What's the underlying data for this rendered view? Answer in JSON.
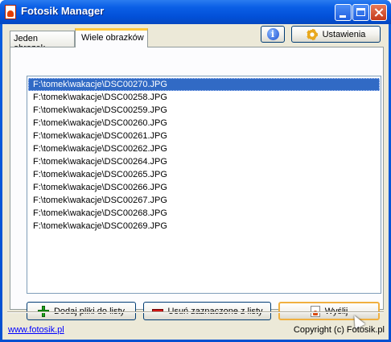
{
  "window": {
    "title": "Fotosik Manager"
  },
  "tabs": [
    {
      "label": "Jeden obrazek",
      "active": false
    },
    {
      "label": "Wiele obrazków",
      "active": true
    }
  ],
  "toolbar": {
    "info_icon": "info-icon",
    "info_glyph": "i",
    "settings_label": "Ustawienia",
    "settings_icon": "gear-icon"
  },
  "file_list": {
    "selected_index": 0,
    "items": [
      "F:\\tomek\\wakacje\\DSC00270.JPG",
      "F:\\tomek\\wakacje\\DSC00258.JPG",
      "F:\\tomek\\wakacje\\DSC00259.JPG",
      "F:\\tomek\\wakacje\\DSC00260.JPG",
      "F:\\tomek\\wakacje\\DSC00261.JPG",
      "F:\\tomek\\wakacje\\DSC00262.JPG",
      "F:\\tomek\\wakacje\\DSC00264.JPG",
      "F:\\tomek\\wakacje\\DSC00265.JPG",
      "F:\\tomek\\wakacje\\DSC00266.JPG",
      "F:\\tomek\\wakacje\\DSC00267.JPG",
      "F:\\tomek\\wakacje\\DSC00268.JPG",
      "F:\\tomek\\wakacje\\DSC00269.JPG"
    ]
  },
  "actions": {
    "add_label": "Dodaj pliki do listy",
    "remove_label": "Usuń zaznaczone z listy",
    "send_label": "Wyślij"
  },
  "footer": {
    "link_text": "www.fotosik.pl",
    "copyright": "Copyright (c) Fotosik.pl"
  },
  "colors": {
    "titlebar": "#0a5fe6",
    "selection": "#316ac5",
    "link": "#0000ff"
  }
}
